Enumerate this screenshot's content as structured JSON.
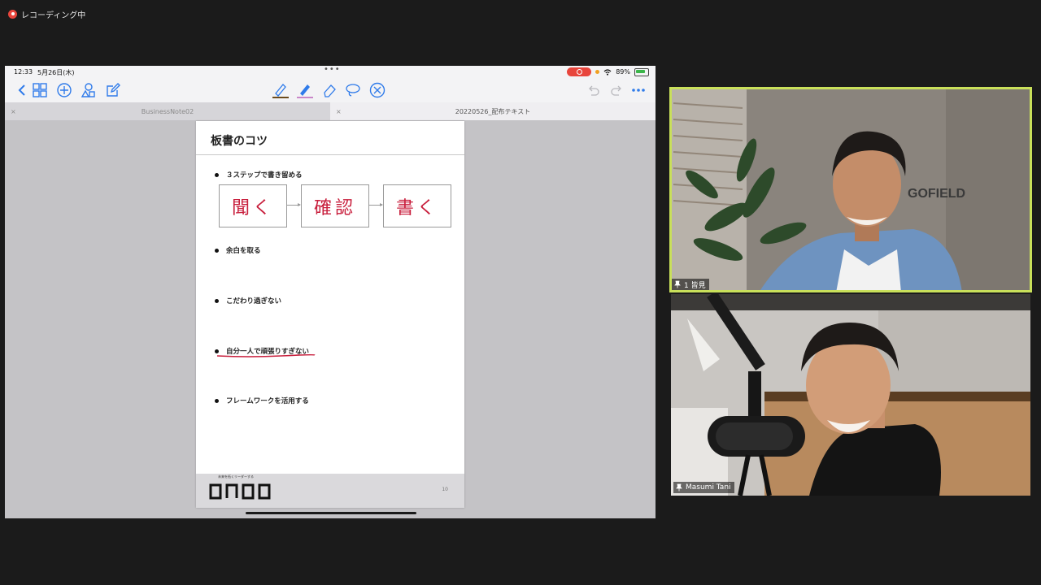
{
  "recording": {
    "label": "レコーディング中",
    "dot_color": "#e8453c"
  },
  "ipad": {
    "status": {
      "time": "12:33",
      "date": "5月26日(木)",
      "battery": "89%"
    },
    "tabs": [
      {
        "label": "BusinessNote02"
      },
      {
        "label": "20220526_配布テキスト"
      }
    ],
    "slide": {
      "title": "板書のコツ",
      "bullets": [
        "３ステップで書き留める",
        "余白を取る",
        "こだわり過ぎない",
        "自分一人で頑張りすぎない",
        "フレームワークを活用する"
      ],
      "handwriting": [
        "聞く",
        "確認",
        "書く"
      ],
      "footer": {
        "tagline": "未来を拓くリーダーする",
        "logo": "ONDO",
        "page": "10"
      },
      "handwriting_color": "#c81e3c"
    },
    "toolbar_icons": [
      "back-icon",
      "grid-icon",
      "add-icon",
      "shapes-icon",
      "compose-icon",
      "pen-icon",
      "highlighter-icon",
      "eraser-icon",
      "lasso-icon",
      "close-circle-icon",
      "undo-icon",
      "redo-icon",
      "more-icon"
    ]
  },
  "participants": [
    {
      "name": "1 皆見",
      "active_speaker": true,
      "highlight_color": "#c9e05a"
    },
    {
      "name": "Masumi Tani",
      "active_speaker": false
    }
  ],
  "video_signage": "GOFIELD"
}
